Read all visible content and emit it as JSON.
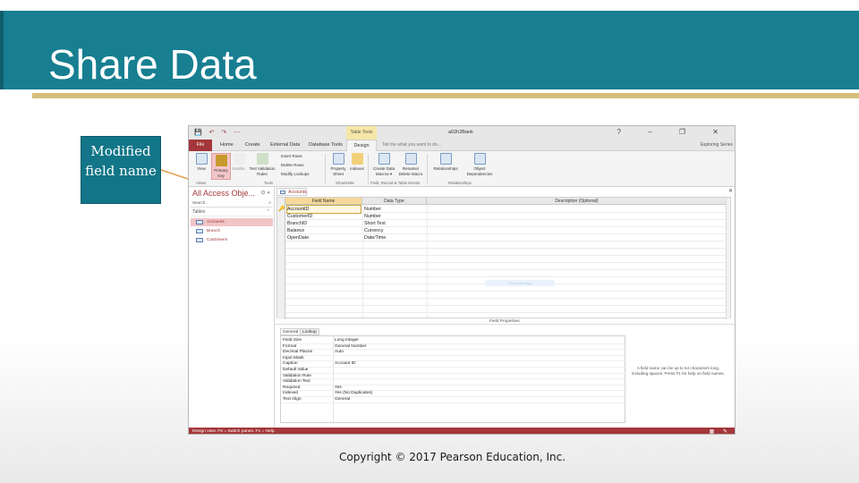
{
  "slide": {
    "title": "Share Data",
    "callout": "Modified field name",
    "copyright": "Copyright © 2017 Pearson Education, Inc."
  },
  "access": {
    "window_title": "a02h2Bank",
    "context_tab": "Table Tools",
    "window_controls": "? – ❐ ✕",
    "quick_access": "💾 ↶ ↷ ⋯",
    "menu": [
      "File",
      "Home",
      "Create",
      "External Data",
      "Database Tools",
      "Design"
    ],
    "tell_me": "Tell me what you want to do...",
    "user": "Exploring Series",
    "ribbon": {
      "view": "View",
      "primary_key": "Primary Key",
      "builder": "Builder",
      "test_validation": "Test Validation Rules",
      "insert_rows": "Insert Rows",
      "delete_rows": "Delete Rows",
      "modify_lookups": "Modify Lookups",
      "property_sheet": "Property Sheet",
      "indexes": "Indexes",
      "create_data_macros": "Create Data Macros ▾",
      "rename_delete_macro": "Rename/ Delete Macro",
      "relationships": "Relationships",
      "object_dependencies": "Object Dependencies",
      "groups": [
        "Views",
        "Tools",
        "Show/Hide",
        "Field, Record & Table Events",
        "Relationships"
      ]
    },
    "nav": {
      "title": "All Access Obje...",
      "search": "Search...",
      "section": "Tables",
      "items": [
        "Accounts",
        "Branch",
        "Customers"
      ]
    },
    "doc_tab": "Accounts",
    "grid": {
      "headers": [
        "Field Name",
        "Data Type",
        "Description (Optional)"
      ],
      "rows": [
        {
          "name": "AccountID",
          "type": "Number"
        },
        {
          "name": "CustomerID",
          "type": "Number"
        },
        {
          "name": "BranchID",
          "type": "Short Text"
        },
        {
          "name": "Balance",
          "type": "Currency"
        },
        {
          "name": "OpenDate",
          "type": "Date/Time"
        }
      ],
      "ghost_tip": "Tell screen tips"
    },
    "field_properties": {
      "title": "Field Properties",
      "tabs": [
        "General",
        "Lookup"
      ],
      "rows": [
        {
          "label": "Field Size",
          "value": "Long Integer"
        },
        {
          "label": "Format",
          "value": "General Number"
        },
        {
          "label": "Decimal Places",
          "value": "Auto"
        },
        {
          "label": "Input Mask",
          "value": ""
        },
        {
          "label": "Caption",
          "value": "Account ID"
        },
        {
          "label": "Default Value",
          "value": ""
        },
        {
          "label": "Validation Rule",
          "value": ""
        },
        {
          "label": "Validation Text",
          "value": ""
        },
        {
          "label": "Required",
          "value": "Yes"
        },
        {
          "label": "Indexed",
          "value": "Yes (No Duplicates)"
        },
        {
          "label": "Text Align",
          "value": "General"
        }
      ],
      "help": "A field name can be up to 64 characters long, including spaces. Press F1 for help on field names."
    },
    "status": "Design view. F6 = Switch panes. F1 = Help.",
    "status_icons": "▦ ✎"
  },
  "colors": {
    "title_bar": "#177f91",
    "gold": "#d6bf7a",
    "access_red": "#a4373a",
    "highlight": "#f6d99a"
  }
}
